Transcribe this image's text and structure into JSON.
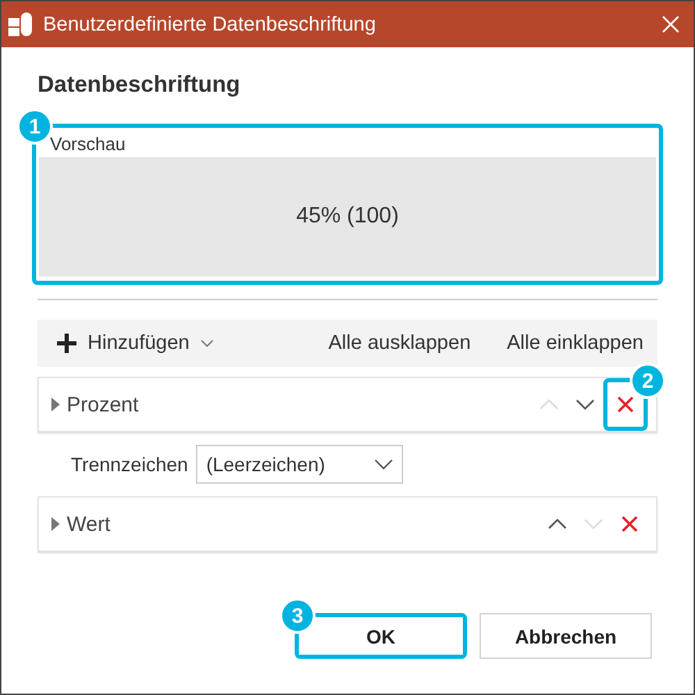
{
  "window": {
    "title": "Benutzerdefinierte Datenbeschriftung"
  },
  "heading": "Datenbeschriftung",
  "preview": {
    "label": "Vorschau",
    "text": "45% (100)",
    "callout": "1"
  },
  "toolbar": {
    "add": "Hinzufügen",
    "expand_all": "Alle ausklappen",
    "collapse_all": "Alle einklappen"
  },
  "items": [
    {
      "kind": "item",
      "label": "Prozent",
      "expanded": false,
      "up_disabled": true,
      "down_disabled": false,
      "delete_callout": "2"
    },
    {
      "kind": "field",
      "label": "Trennzeichen",
      "value": "(Leerzeichen)"
    },
    {
      "kind": "item",
      "label": "Wert",
      "expanded": false,
      "up_disabled": false,
      "down_disabled": true
    }
  ],
  "buttons": [
    {
      "label": "OK",
      "callout": "3"
    },
    {
      "label": "Abbrechen"
    }
  ]
}
